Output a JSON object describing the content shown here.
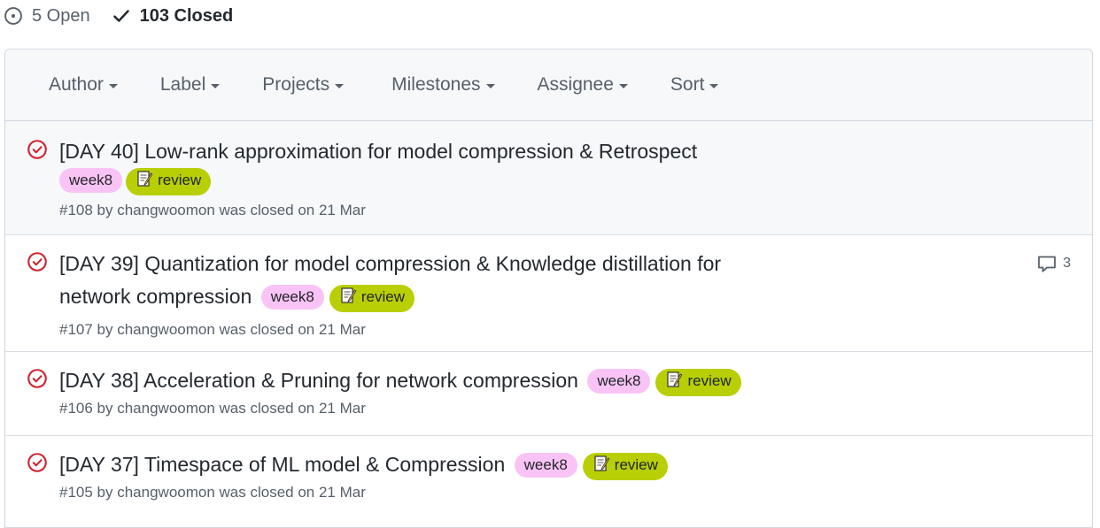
{
  "states": {
    "open_label": "5 Open",
    "closed_label": "103 Closed"
  },
  "filters": {
    "author": "Author",
    "label": "Label",
    "projects": "Projects",
    "milestones": "Milestones",
    "assignee": "Assignee",
    "sort": "Sort"
  },
  "issues": [
    {
      "title": "[DAY 40] Low-rank approximation for model compression & Retrospect",
      "labels": [
        "week8",
        "review"
      ],
      "meta": "#108 by changwoomon was closed on 21 Mar",
      "comments": null
    },
    {
      "title_line1": "[DAY 39] Quantization for model compression & Knowledge distillation for",
      "title_line2": "network compression",
      "labels": [
        "week8",
        "review"
      ],
      "meta": "#107 by changwoomon was closed on 21 Mar",
      "comments": "3"
    },
    {
      "title": "[DAY 38] Acceleration & Pruning for network compression",
      "labels": [
        "week8",
        "review"
      ],
      "meta": "#106 by changwoomon was closed on 21 Mar",
      "comments": null
    },
    {
      "title": "[DAY 37] Timespace of ML model & Compression",
      "labels": [
        "week8",
        "review"
      ],
      "meta": "#105 by changwoomon was closed on 21 Mar",
      "comments": null
    }
  ],
  "colors": {
    "closed_icon": "#cf222e",
    "label_week8": "#f9c4f5",
    "label_review": "#b8cf06"
  }
}
